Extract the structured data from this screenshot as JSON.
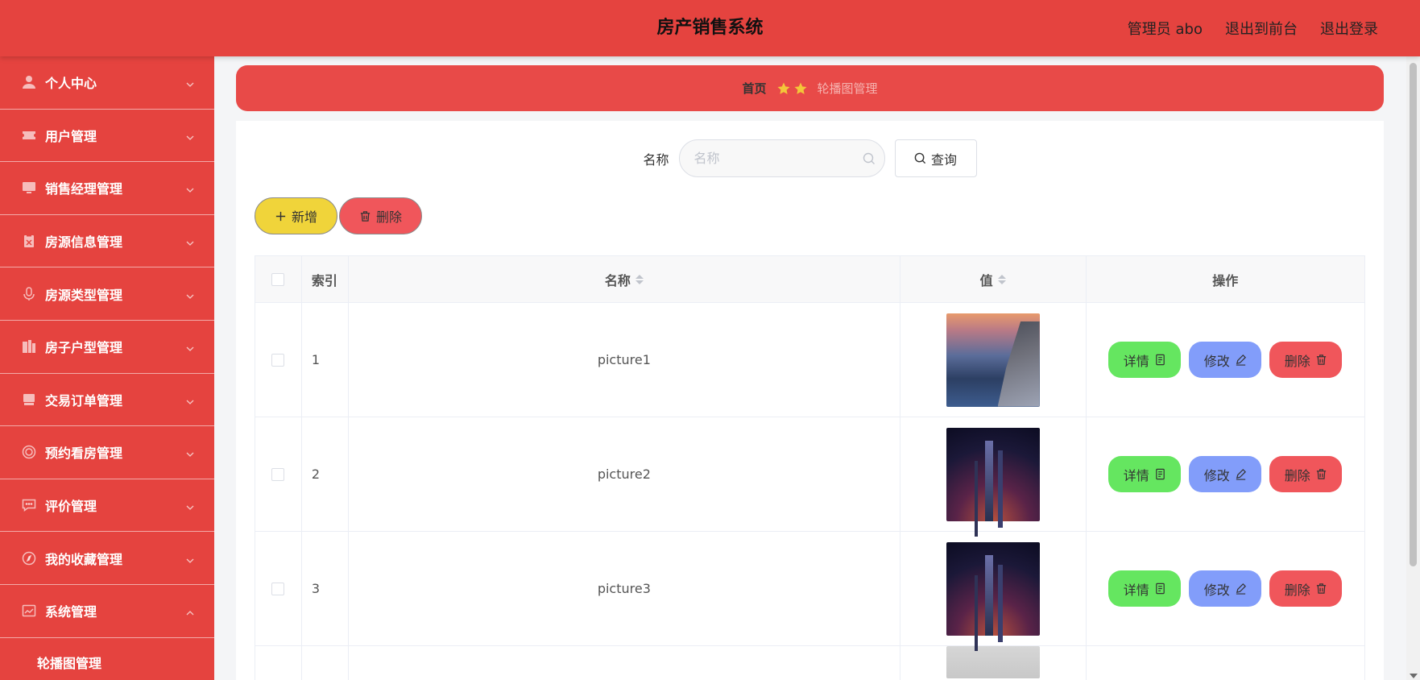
{
  "header": {
    "title": "房产销售系统",
    "admin": "管理员 abo",
    "to_frontend": "退出到前台",
    "logout": "退出登录"
  },
  "sidebar": {
    "items": [
      {
        "label": "个人中心",
        "icon": "person-icon"
      },
      {
        "label": "用户管理",
        "icon": "ticket-icon"
      },
      {
        "label": "销售经理管理",
        "icon": "monitor-icon"
      },
      {
        "label": "房源信息管理",
        "icon": "clipboard-icon"
      },
      {
        "label": "房源类型管理",
        "icon": "microphone-icon"
      },
      {
        "label": "房子户型管理",
        "icon": "office-building-icon"
      },
      {
        "label": "交易订单管理",
        "icon": "desktop-icon"
      },
      {
        "label": "预约看房管理",
        "icon": "target-icon"
      },
      {
        "label": "评价管理",
        "icon": "chat-icon"
      },
      {
        "label": "我的收藏管理",
        "icon": "compass-icon"
      },
      {
        "label": "系统管理",
        "icon": "chart-window-icon",
        "expanded": true
      }
    ],
    "submenu": [
      "轮播图管理"
    ]
  },
  "breadcrumb": {
    "home": "首页",
    "current": "轮播图管理",
    "separator_icon": "star-icon"
  },
  "search": {
    "label": "名称",
    "placeholder": "名称",
    "button": "查询"
  },
  "actions": {
    "add": "新增",
    "delete": "删除"
  },
  "table": {
    "headers": {
      "index": "索引",
      "name": "名称",
      "value": "值",
      "ops": "操作"
    },
    "rows": [
      {
        "index": "1",
        "name": "picture1"
      },
      {
        "index": "2",
        "name": "picture2"
      },
      {
        "index": "3",
        "name": "picture3"
      }
    ],
    "ops": {
      "detail": "详情",
      "edit": "修改",
      "delete": "删除"
    }
  },
  "colors": {
    "primary": "#e5433f",
    "add": "#f0d43a",
    "delete": "#f0565b",
    "detail": "#65e660",
    "edit": "#829dfa"
  }
}
